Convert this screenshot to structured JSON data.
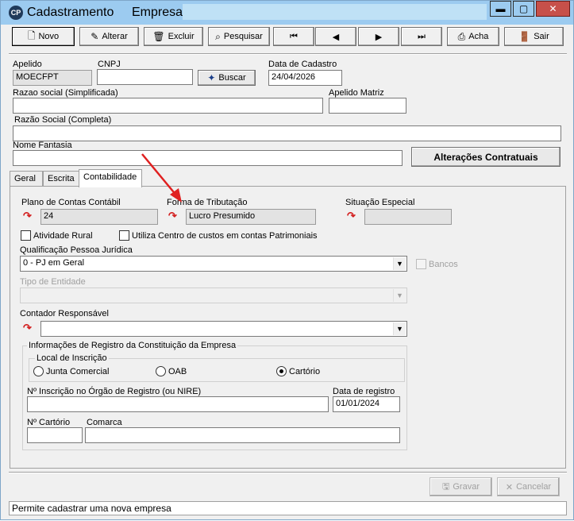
{
  "window": {
    "title": "Cadastramento",
    "empresa_label": "Empresa:",
    "minimize": "▬",
    "maximize": "▢",
    "close": "✕",
    "app_icon": "CP"
  },
  "toolbar": {
    "novo": "Novo",
    "alterar": "Alterar",
    "excluir": "Excluir",
    "pesquisar": "Pesquisar",
    "first": "⏮",
    "prev": "◀",
    "next": "▶",
    "last": "⏭",
    "acha": "Acha",
    "sair": "Sair"
  },
  "form": {
    "apelido_label": "Apelido",
    "apelido_value": "MOECFPT",
    "cnpj_label": "CNPJ",
    "cnpj_value": "",
    "buscar": "Buscar",
    "data_cadastro_label": "Data de Cadastro",
    "data_cadastro_value": "24/04/2026",
    "razao_simpl_label": "Razao social (Simplificada)",
    "razao_simpl_value": "",
    "apelido_matriz_label": "Apelido Matriz",
    "apelido_matriz_value": "",
    "razao_completa_label": "Razão Social (Completa)",
    "razao_completa_value": "",
    "nome_fantasia_label": "Nome Fantasia",
    "nome_fantasia_value": "",
    "alteracoes_btn": "Alterações Contratuais"
  },
  "tabs": [
    {
      "label": "Geral"
    },
    {
      "label": "Escrita"
    },
    {
      "label": "Contabilidade"
    }
  ],
  "contabilidade": {
    "plano_label": "Plano de Contas Contábil",
    "plano_value": "24",
    "forma_label": "Forma de Tributação",
    "forma_value": "Lucro Presumido",
    "situacao_label": "Situação Especial",
    "situacao_value": "",
    "atividade_rural": "Atividade Rural",
    "centro_custos": "Utiliza Centro de custos em contas Patrimoniais",
    "qualificacao_label": "Qualificação Pessoa Jurídica",
    "qualificacao_value": "0 - PJ em Geral",
    "bancos": "Bancos",
    "tipo_entidade_label": "Tipo de Entidade",
    "tipo_entidade_value": "",
    "contador_label": "Contador Responsável",
    "contador_value": "",
    "registro_group": "Informações de Registro da Constituição da Empresa",
    "local_group": "Local de Inscrição",
    "radio_junta": "Junta Comercial",
    "radio_oab": "OAB",
    "radio_cartorio": "Cartório",
    "inscricao_label": "Nº Inscrição no Órgão de Registro (ou NIRE)",
    "inscricao_value": "",
    "data_registro_label": "Data de registro",
    "data_registro_value": "01/01/2024",
    "num_cartorio_label": "Nº Cartório",
    "num_cartorio_value": "",
    "comarca_label": "Comarca",
    "comarca_value": ""
  },
  "footer": {
    "gravar": "Gravar",
    "cancelar": "Cancelar",
    "status": "Permite cadastrar uma nova empresa"
  },
  "colors": {
    "titlebar": "#9ccbf0",
    "close": "#c7504a",
    "annotation_arrow": "#e02020"
  }
}
